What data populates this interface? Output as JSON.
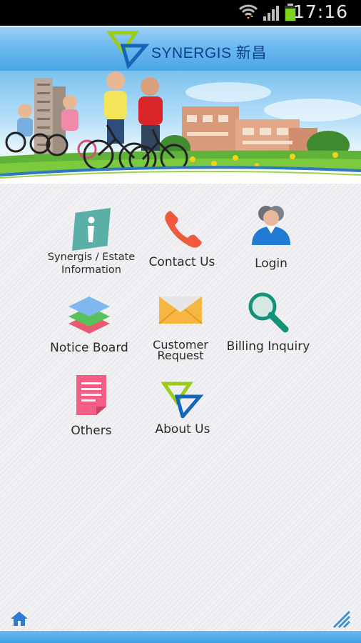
{
  "status_bar": {
    "time": "17:16",
    "icons": [
      "wifi-icon",
      "signal-icon",
      "battery-icon"
    ],
    "battery_color": "#7ed321"
  },
  "header": {
    "brand_text": "SYNERGIS 新昌",
    "background": "#5fb2ec"
  },
  "menu": [
    {
      "label": "Synergis / Estate Information",
      "icon": "info-icon"
    },
    {
      "label": "Contact Us",
      "icon": "phone-icon"
    },
    {
      "label": "Login",
      "icon": "user-icon"
    },
    {
      "label": "Notice Board",
      "icon": "layers-icon"
    },
    {
      "label": "Customer Request",
      "icon": "envelope-icon"
    },
    {
      "label": "Billing Inquiry",
      "icon": "magnifier-icon"
    },
    {
      "label": "Others",
      "icon": "document-icon"
    },
    {
      "label": "About Us",
      "icon": "synergis-logo-icon"
    }
  ],
  "footer": {
    "icons": [
      "home-icon",
      "resize-handle-icon"
    ],
    "accent": "#3d9ee0"
  }
}
